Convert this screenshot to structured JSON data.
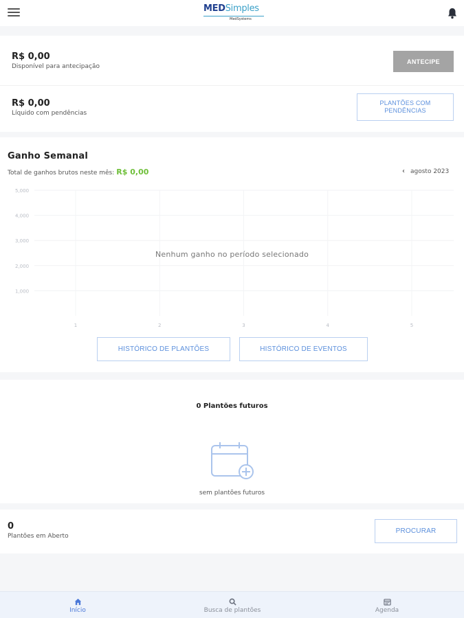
{
  "header": {
    "logo_main": "MED",
    "logo_accent": "Simples",
    "logo_sub": "MedSystems"
  },
  "balance": {
    "amount": "R$ 0,00",
    "label": "Disponível para antecipação",
    "button": "ANTECIPE"
  },
  "pending": {
    "amount": "R$ 0,00",
    "label": "Líquido com pendências",
    "button_line1": "PLANTÕES COM",
    "button_line2": "PENDÊNCIAS"
  },
  "weekly": {
    "title": "Ganho Semanal",
    "total_label": "Total de ganhos brutos neste mês:",
    "total_value": "R$ 0,00",
    "month": "agosto 2023",
    "empty_message": "Nenhum ganho no período selecionado",
    "history_shifts": "HISTÓRICO DE PLANTÕES",
    "history_events": "HISTÓRICO DE EVENTOS"
  },
  "chart_data": {
    "type": "bar",
    "categories": [
      "1",
      "2",
      "3",
      "4",
      "5"
    ],
    "values": [
      0,
      0,
      0,
      0,
      0
    ],
    "y_ticks": [
      "5,000",
      "4,000",
      "3,000",
      "2,000",
      "1,000"
    ],
    "ylim": [
      0,
      5000
    ],
    "grid": true,
    "title": "",
    "xlabel": "",
    "ylabel": ""
  },
  "future": {
    "title": "0 Plantões futuros",
    "empty": "sem plantões futuros"
  },
  "open": {
    "count": "0",
    "label": "Plantões em Aberto",
    "button": "PROCURAR"
  },
  "nav": {
    "items": [
      {
        "label": "Início",
        "icon": "home-icon"
      },
      {
        "label": "Busca de plantões",
        "icon": "search-icon"
      },
      {
        "label": "Agenda",
        "icon": "calendar-icon"
      }
    ]
  },
  "colors": {
    "accent": "#5b8fdc",
    "green": "#6fbf3a",
    "gray_button": "#a4a4a4"
  }
}
